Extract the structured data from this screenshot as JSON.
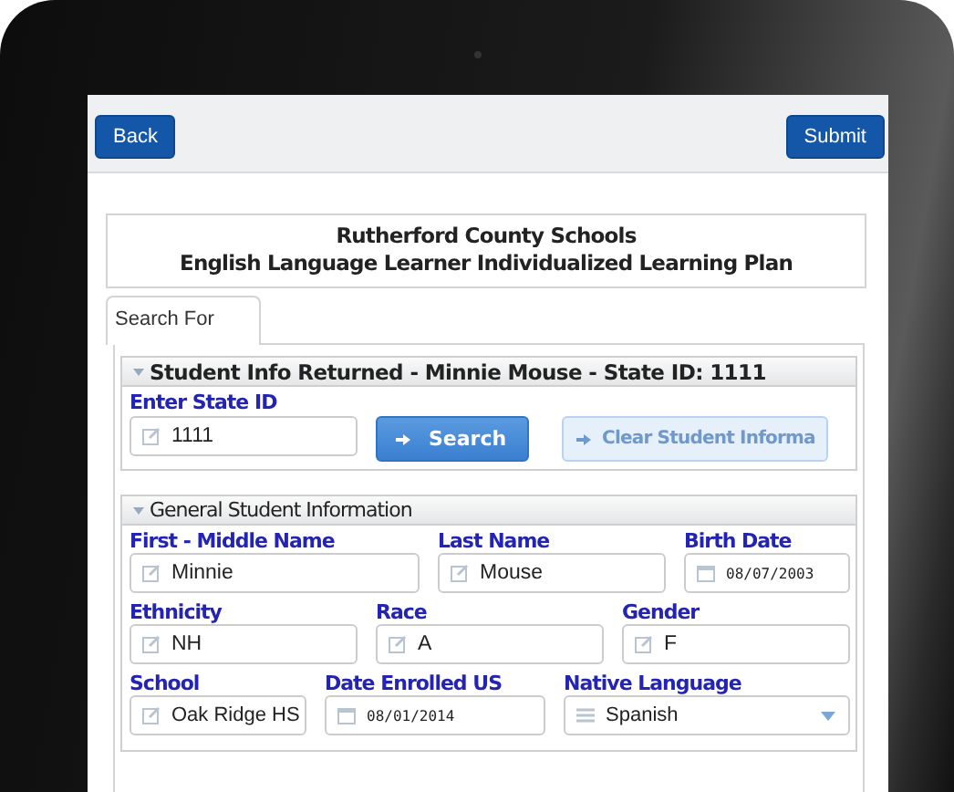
{
  "toolbar": {
    "back": "Back",
    "submit": "Submit"
  },
  "header": {
    "line_1": "Rutherford County Schools",
    "line_2": "English Language Learner Individualized Learning Plan"
  },
  "tabs": [
    {
      "label": "Search For",
      "selected": true
    }
  ],
  "sections": [
    {
      "title": "Student Info Returned - Minnie Mouse - State ID: 1111",
      "expanded": true,
      "bold": true,
      "search": {
        "label": "Enter State ID",
        "value": "1111",
        "buttons": [
          {
            "label": "Search",
            "disabled": false
          },
          {
            "label": "Clear Student Informa",
            "disabled": true
          }
        ]
      }
    },
    {
      "title": "General Student Information",
      "expanded": true,
      "bold": false,
      "rows": [
        [
          {
            "label": "First - Middle Name",
            "value": "Minnie",
            "kind": "text"
          },
          {
            "label": "Last Name",
            "value": "Mouse",
            "kind": "text"
          },
          {
            "label": "Birth Date",
            "value": "08/07/2003",
            "kind": "date"
          }
        ],
        [
          {
            "label": "Ethnicity",
            "value": "NH",
            "kind": "text"
          },
          {
            "label": "Race",
            "value": "A",
            "kind": "text"
          },
          {
            "label": "Gender",
            "value": "F",
            "kind": "text"
          }
        ],
        [
          {
            "label": "School",
            "value": "Oak Ridge HS",
            "kind": "text"
          },
          {
            "label": "Date Enrolled US",
            "value": "08/01/2014",
            "kind": "date"
          },
          {
            "label": "Native Language",
            "value": "Spanish",
            "kind": "select"
          }
        ]
      ]
    }
  ]
}
